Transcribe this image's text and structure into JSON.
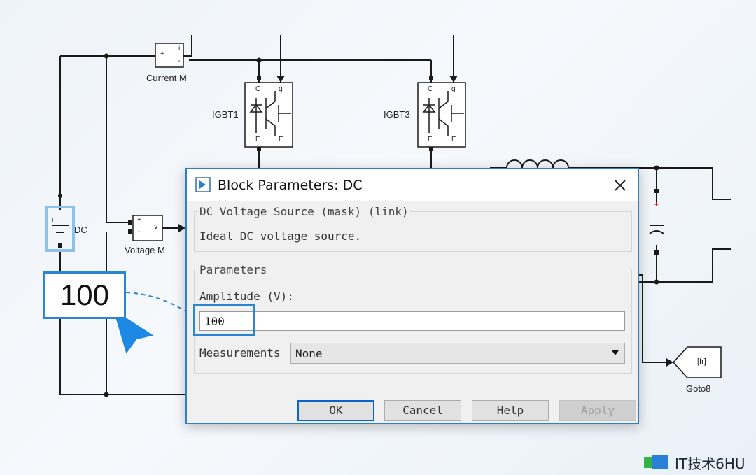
{
  "diagram": {
    "labels": {
      "current_m": "Current M",
      "voltage_m": "Voltage M",
      "igbt1": "IGBT1",
      "igbt3": "IGBT3",
      "dc": "DC",
      "goto8": "Goto8",
      "goto_tag": "[Ir]"
    },
    "pins": {
      "plus": "+",
      "minus": "-",
      "i": "i",
      "v": "v",
      "c": "C",
      "g": "g",
      "e": "E"
    }
  },
  "callout": {
    "value": "100"
  },
  "dialog": {
    "title": "Block Parameters: DC",
    "block_type": "DC Voltage Source (mask) (link)",
    "description": "Ideal DC voltage source.",
    "parameters_title": "Parameters",
    "amplitude_label": "Amplitude (V):",
    "amplitude_value": "100",
    "measurements_label": "Measurements",
    "measurements_value": "None",
    "buttons": {
      "ok": "OK",
      "cancel": "Cancel",
      "help": "Help",
      "apply": "Apply"
    }
  },
  "watermark": {
    "text": "IT技术6HU"
  },
  "colors": {
    "accent": "#2a86d2",
    "dialog_border": "#2e7fc6",
    "cursor": "#1e88e5"
  }
}
